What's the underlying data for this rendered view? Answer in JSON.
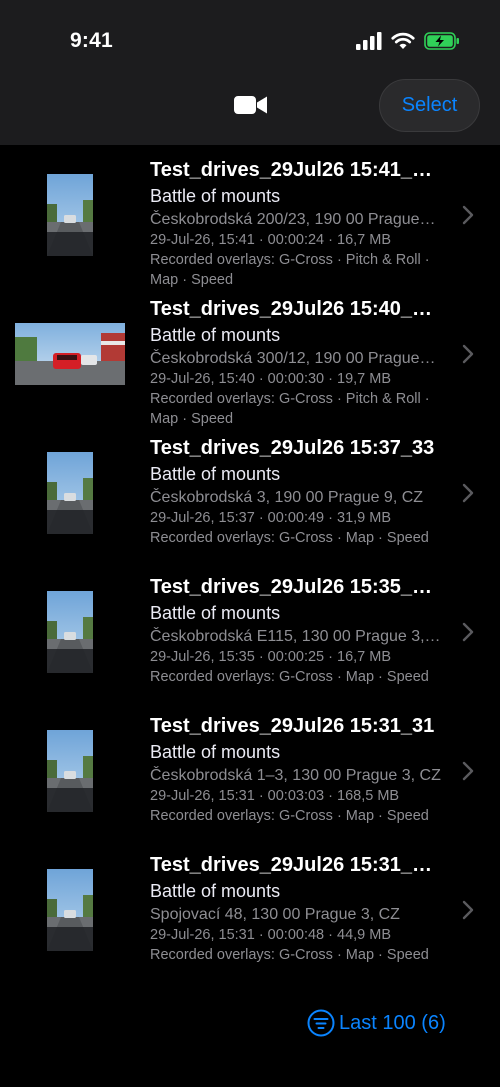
{
  "status_bar": {
    "time": "9:41"
  },
  "nav": {
    "select_label": "Select"
  },
  "videos": [
    {
      "title": "Test_drives_29Jul26 15:41_…",
      "subtitle": "Battle of mounts",
      "address": "Českobrodská 200/23, 190 00 Prague…",
      "meta": "29-Jul-26, 15:41 · 00:00:24 · 16,7 MB",
      "overlays": "Recorded overlays: G-Cross · Pitch & Roll · Map · Speed",
      "thumb": "portrait"
    },
    {
      "title": "Test_drives_29Jul26 15:40_…",
      "subtitle": "Battle of mounts",
      "address": "Českobrodská 300/12, 190 00 Prague…",
      "meta": "29-Jul-26, 15:40 · 00:00:30 · 19,7 MB",
      "overlays": "Recorded overlays: G-Cross · Pitch & Roll · Map · Speed",
      "thumb": "landscape"
    },
    {
      "title": "Test_drives_29Jul26 15:37_33",
      "subtitle": "Battle of mounts",
      "address": "Českobrodská 3, 190 00 Prague 9, CZ",
      "meta": "29-Jul-26, 15:37 · 00:00:49 · 31,9 MB",
      "overlays": "Recorded overlays: G-Cross · Map · Speed",
      "thumb": "portrait"
    },
    {
      "title": "Test_drives_29Jul26 15:35_…",
      "subtitle": "Battle of mounts",
      "address": "Českobrodská E115, 130 00 Prague 3,…",
      "meta": "29-Jul-26, 15:35 · 00:00:25 · 16,7 MB",
      "overlays": "Recorded overlays: G-Cross · Map · Speed",
      "thumb": "portrait"
    },
    {
      "title": "Test_drives_29Jul26 15:31_31",
      "subtitle": "Battle of mounts",
      "address": "Českobrodská 1–3, 130 00 Prague 3, CZ",
      "meta": "29-Jul-26, 15:31 · 00:03:03 · 168,5 MB",
      "overlays": "Recorded overlays: G-Cross · Map · Speed",
      "thumb": "portrait"
    },
    {
      "title": "Test_drives_29Jul26 15:31_…",
      "subtitle": "Battle of mounts",
      "address": "Spojovací 48, 130 00 Prague 3, CZ",
      "meta": "29-Jul-26, 15:31 · 00:00:48 · 44,9 MB",
      "overlays": "Recorded overlays: G-Cross · Map · Speed",
      "thumb": "portrait"
    }
  ],
  "footer": {
    "filter_label": "Last 100 (6)"
  },
  "colors": {
    "accent": "#0a84ff",
    "battery": "#30d158",
    "secondary_text": "#8e8e93"
  }
}
